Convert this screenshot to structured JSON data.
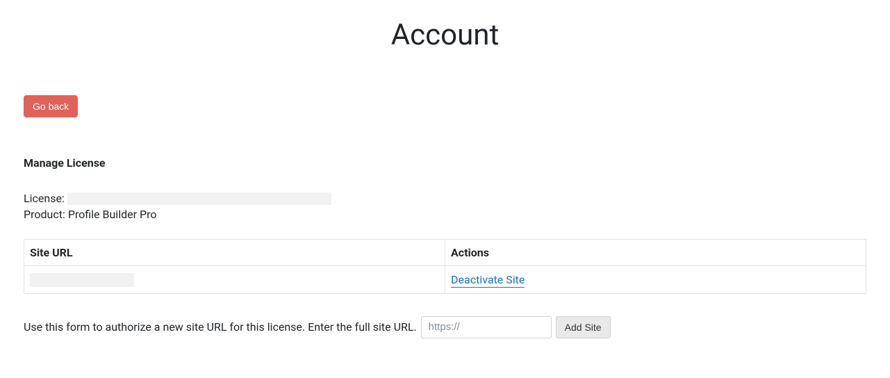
{
  "page": {
    "title": "Account"
  },
  "buttons": {
    "go_back": "Go back",
    "add_site": "Add Site"
  },
  "manage_license": {
    "heading": "Manage License",
    "license_label": "License:",
    "license_value": "",
    "product_label": "Product:",
    "product_value": "Profile Builder Pro"
  },
  "table": {
    "headers": {
      "site_url": "Site URL",
      "actions": "Actions"
    },
    "rows": [
      {
        "site_url": "",
        "action_label": "Deactivate Site"
      }
    ]
  },
  "form": {
    "description": "Use this form to authorize a new site URL for this license. Enter the full site URL.",
    "placeholder": "https://"
  }
}
